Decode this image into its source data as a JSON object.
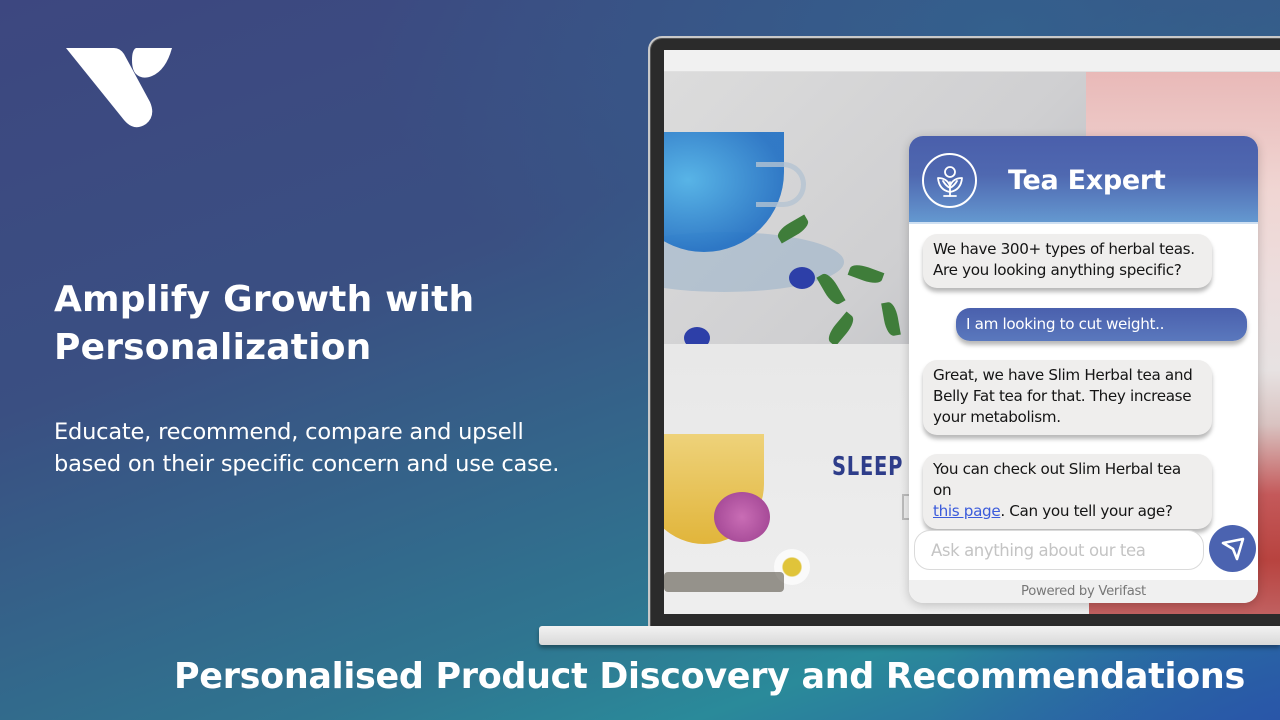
{
  "brand": {
    "logo_icon": "verifast-v-logo-icon"
  },
  "hero": {
    "headline_line1": "Amplify Growth with",
    "headline_line2": "Personalization",
    "subtext_line1": "Educate, recommend, compare and upsell",
    "subtext_line2": "based on their specific concern and use case."
  },
  "footer": {
    "title": "Personalised Product Discovery and Recommendations"
  },
  "website_preview": {
    "banner_text": "SLEEP"
  },
  "chat": {
    "title": "Tea Expert",
    "avatar_icon": "tea-leaf-icon",
    "messages": [
      {
        "sender": "bot",
        "line1": "We have 300+ types of herbal teas.",
        "line2": "Are you looking anything specific?"
      },
      {
        "sender": "user",
        "text": "I am looking to cut weight.."
      },
      {
        "sender": "bot",
        "line1": "Great, we have Slim Herbal tea and",
        "line2": "Belly Fat tea for that. They increase",
        "line3": "your metabolism."
      },
      {
        "sender": "bot",
        "line1": "You can check out Slim Herbal tea on",
        "link_text": "this page",
        "line2_rest": ". Can you tell your age?"
      }
    ],
    "input": {
      "value": "",
      "placeholder": "Ask anything about our tea"
    },
    "send_icon": "send-icon",
    "powered_by": "Powered by Verifast"
  },
  "colors": {
    "accent": "#4b63b0",
    "header_gradient_top": "#4a5fab",
    "header_gradient_bottom": "#6498d0",
    "bot_bubble": "#efeeed",
    "link": "#3b5bdb"
  }
}
